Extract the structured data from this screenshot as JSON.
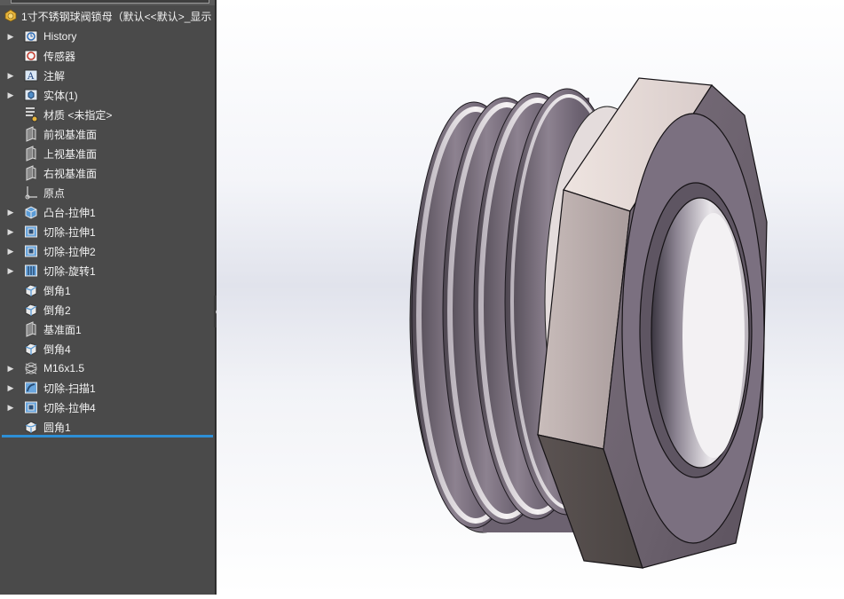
{
  "feature_tree": {
    "root": {
      "label": "1寸不锈钢球阀锁母（默认<<默认>_显示",
      "icon": "part-icon"
    },
    "items": [
      {
        "label": "History",
        "icon": "history-icon",
        "expandable": true
      },
      {
        "label": "传感器",
        "icon": "sensor-icon",
        "expandable": false
      },
      {
        "label": "注解",
        "icon": "annotation-icon",
        "expandable": true
      },
      {
        "label": "实体(1)",
        "icon": "solid-bodies-icon",
        "expandable": true
      },
      {
        "label": "材质 <未指定>",
        "icon": "material-icon",
        "expandable": false
      },
      {
        "label": "前视基准面",
        "icon": "plane-icon",
        "expandable": false
      },
      {
        "label": "上视基准面",
        "icon": "plane-icon",
        "expandable": false
      },
      {
        "label": "右视基准面",
        "icon": "plane-icon",
        "expandable": false
      },
      {
        "label": "原点",
        "icon": "origin-icon",
        "expandable": false
      },
      {
        "label": "凸台-拉伸1",
        "icon": "boss-extrude-icon",
        "expandable": true
      },
      {
        "label": "切除-拉伸1",
        "icon": "cut-extrude-icon",
        "expandable": true
      },
      {
        "label": "切除-拉伸2",
        "icon": "cut-extrude-icon",
        "expandable": true
      },
      {
        "label": "切除-旋转1",
        "icon": "cut-revolve-icon",
        "expandable": true
      },
      {
        "label": "倒角1",
        "icon": "chamfer-icon",
        "expandable": false
      },
      {
        "label": "倒角2",
        "icon": "chamfer-icon",
        "expandable": false
      },
      {
        "label": "基准面1",
        "icon": "plane-icon",
        "expandable": false
      },
      {
        "label": "倒角4",
        "icon": "chamfer-icon",
        "expandable": false
      },
      {
        "label": "M16x1.5",
        "icon": "cosmetic-thread-icon",
        "expandable": true
      },
      {
        "label": "切除-扫描1",
        "icon": "cut-sweep-icon",
        "expandable": true
      },
      {
        "label": "切除-拉伸4",
        "icon": "cut-extrude-icon",
        "expandable": true
      },
      {
        "label": "圆角1",
        "icon": "fillet-icon",
        "expandable": false
      }
    ]
  },
  "viewport": {
    "model": "hex-lock-nut-3d-model"
  },
  "colors": {
    "panel": "#4a4a4a",
    "rollback": "#2d8fd6",
    "metal": "#6e6470"
  }
}
